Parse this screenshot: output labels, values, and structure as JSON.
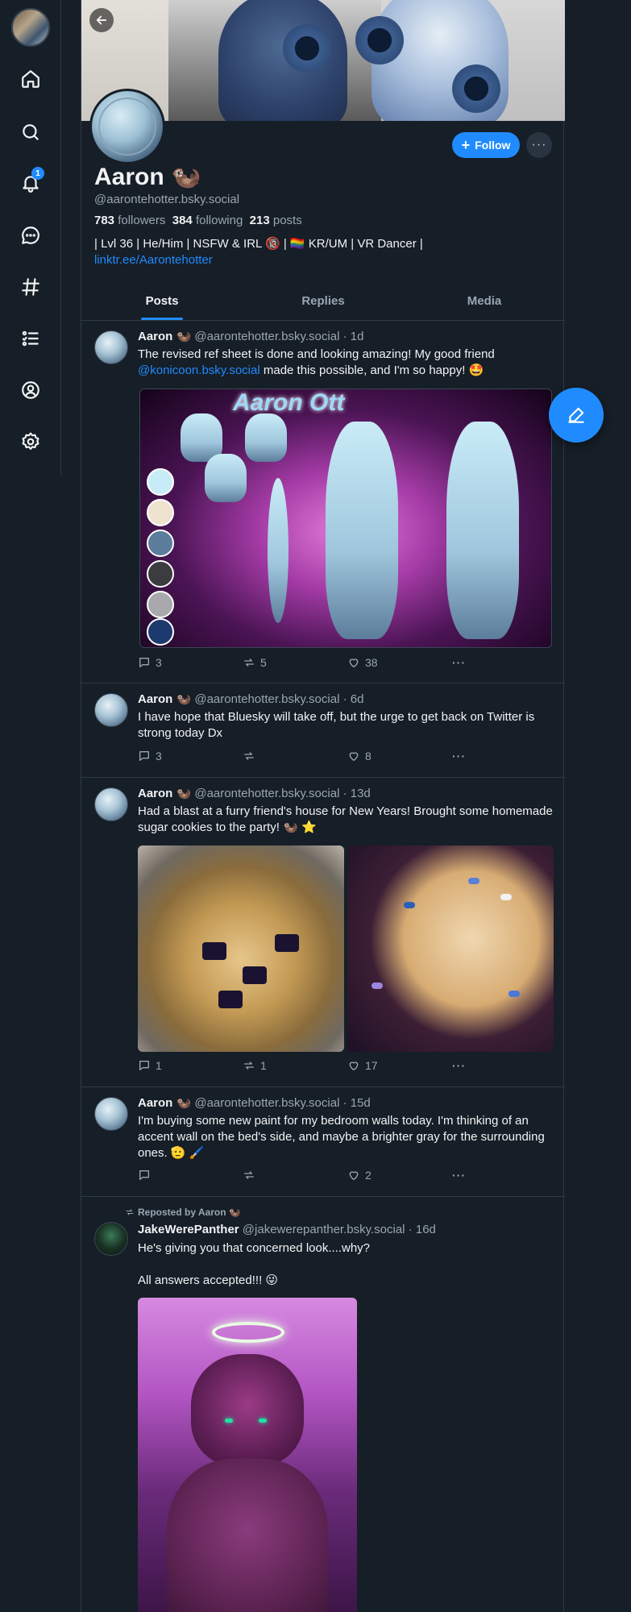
{
  "nav": {
    "notification_badge": "1"
  },
  "profile": {
    "name": "Aaron 🦦",
    "handle": "@aarontehotter.bsky.social",
    "followers_count": "783",
    "followers_label": "followers",
    "following_count": "384",
    "following_label": "following",
    "posts_count": "213",
    "posts_label": "posts",
    "bio": "| Lvl 36 | He/Him | NSFW & IRL 🔞 | 🏳️‍🌈 KR/UM | VR Dancer |",
    "link": "linktr.ee/Aarontehotter",
    "follow_label": "Follow",
    "more_label": "···"
  },
  "tabs": [
    {
      "label": "Posts"
    },
    {
      "label": "Replies"
    },
    {
      "label": "Media"
    }
  ],
  "refsheet_title": "Aaron Ott",
  "posts": [
    {
      "author": "Aaron 🦦",
      "handle": "@aarontehotter.bsky.social",
      "time": "· 1d",
      "text_a": "The revised ref sheet is done and looking amazing! My good friend",
      "mention": "@konicoon.bsky.social",
      "text_b": " made this possible, and I'm so happy! 🤩",
      "replies": "3",
      "reposts": "5",
      "likes": "38"
    },
    {
      "author": "Aaron 🦦",
      "handle": "@aarontehotter.bsky.social",
      "time": "· 6d",
      "text": "I have hope that Bluesky will take off, but the urge to get back on Twitter is strong today Dx",
      "replies": "3",
      "reposts": "",
      "likes": "8"
    },
    {
      "author": "Aaron 🦦",
      "handle": "@aarontehotter.bsky.social",
      "time": "· 13d",
      "text": "Had a blast at a furry friend's house for New Years! Brought some homemade sugar cookies to the party! 🦦 ⭐",
      "replies": "1",
      "reposts": "1",
      "likes": "17"
    },
    {
      "author": "Aaron 🦦",
      "handle": "@aarontehotter.bsky.social",
      "time": "· 15d",
      "text": "I'm buying some new paint for my bedroom walls today. I'm thinking of an accent wall on the bed's side, and maybe a brighter gray for the surrounding ones. 🫡 🖌️",
      "replies": "",
      "reposts": "",
      "likes": "2"
    },
    {
      "repost_label": "Reposted by Aaron 🦦",
      "author": "JakeWerePanther",
      "handle": "@jakewerepanther.bsky.social",
      "time": "· 16d",
      "text_a": "He's giving you that concerned look....why?",
      "text_b": "All answers accepted!!! 😜"
    }
  ],
  "more_dots": "···"
}
